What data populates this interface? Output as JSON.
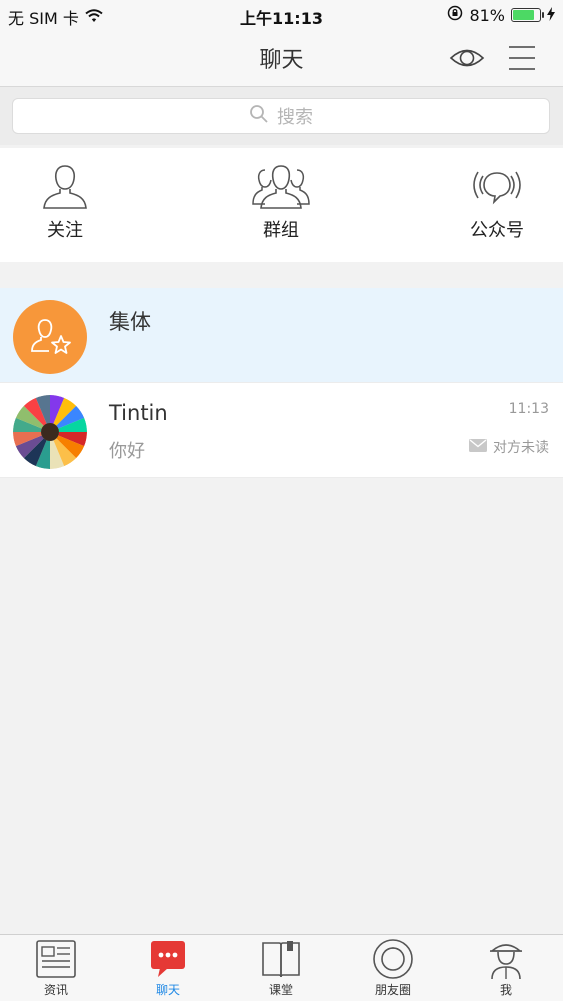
{
  "status_bar": {
    "carrier": "无 SIM 卡",
    "time": "上午11:13",
    "battery": "81%",
    "battery_level": 0.81,
    "icons": [
      "wifi-icon",
      "orientation-lock-icon",
      "battery-icon",
      "charging-icon"
    ]
  },
  "nav": {
    "title": "聊天",
    "icons": [
      "eye-icon",
      "menu-icon"
    ]
  },
  "search": {
    "placeholder": "搜索",
    "icon": "search-icon"
  },
  "quick": {
    "items": [
      {
        "label": "关注",
        "icon": "person-icon"
      },
      {
        "label": "群组",
        "icon": "group-icon"
      },
      {
        "label": "公众号",
        "icon": "broadcast-icon"
      }
    ]
  },
  "chats": [
    {
      "name": "集体",
      "time": "",
      "preview": "",
      "status": "",
      "avatar": "group-star-avatar",
      "avatar_color": "#f7973a",
      "selected": true
    },
    {
      "name": "Tintin",
      "time": "11:13",
      "preview": "你好",
      "status": "对方未读",
      "avatar": "colored-pencils-avatar",
      "selected": false
    }
  ],
  "tabs": [
    {
      "label": "资讯",
      "icon": "news-icon",
      "active": false
    },
    {
      "label": "聊天",
      "icon": "chat-icon",
      "active": true
    },
    {
      "label": "课堂",
      "icon": "book-icon",
      "active": false
    },
    {
      "label": "朋友圈",
      "icon": "camera-lens-icon",
      "active": false
    },
    {
      "label": "我",
      "icon": "profile-icon",
      "active": false
    }
  ],
  "colors": {
    "accent": "#1e88e5",
    "chat_tab_red": "#e53935",
    "selected_row": "#e8f4fd",
    "battery_green": "#4cd964"
  }
}
